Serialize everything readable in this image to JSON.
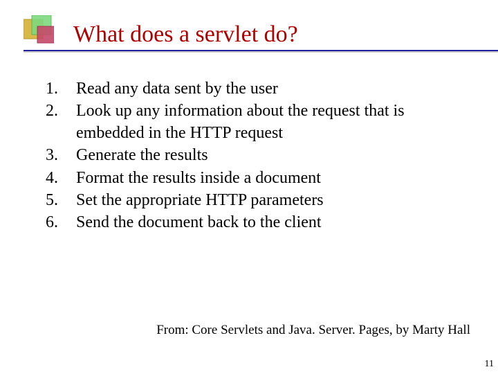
{
  "title": "What does a servlet do?",
  "items": [
    {
      "num": "1.",
      "text": "Read any data sent by the user"
    },
    {
      "num": "2.",
      "text": "Look up any information about the request that is embedded in the HTTP request"
    },
    {
      "num": "3.",
      "text": "Generate the results"
    },
    {
      "num": "4.",
      "text": "Format the results inside a document"
    },
    {
      "num": "5.",
      "text": "Set the appropriate HTTP parameters"
    },
    {
      "num": "6.",
      "text": "Send the document back to the client"
    }
  ],
  "citation": "From: Core Servlets and Java. Server. Pages, by Marty Hall",
  "page_number": "11",
  "colors": {
    "title": "#b00000",
    "underline": "#1f1fa0"
  }
}
